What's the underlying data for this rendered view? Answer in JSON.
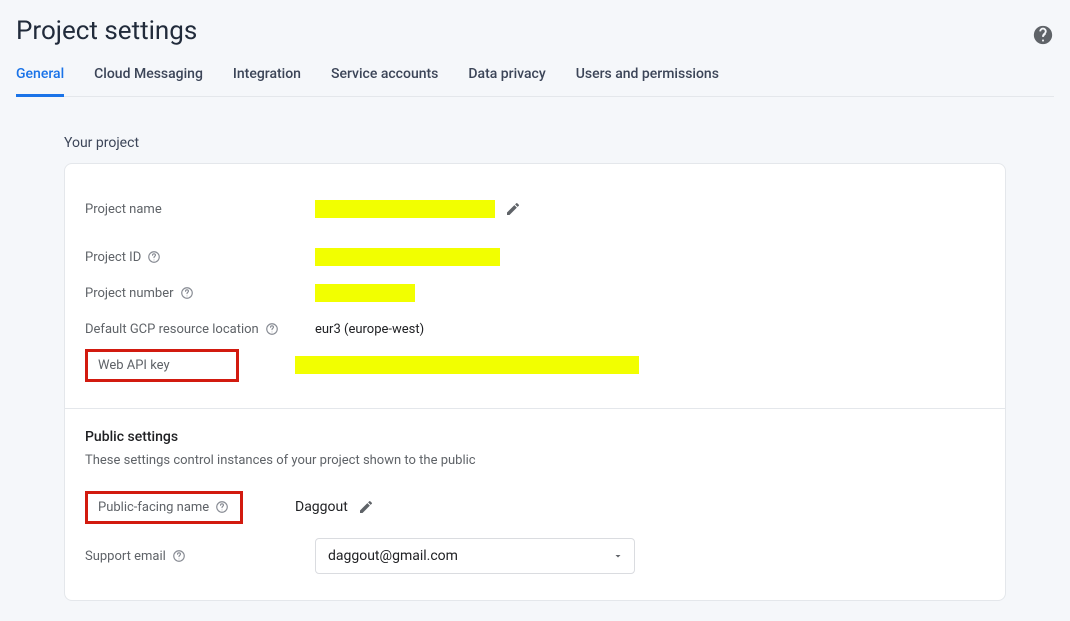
{
  "header": {
    "title": "Project settings"
  },
  "tabs": {
    "general": "General",
    "cloud_messaging": "Cloud Messaging",
    "integration": "Integration",
    "service_accounts": "Service accounts",
    "data_privacy": "Data privacy",
    "users_permissions": "Users and permissions"
  },
  "section": {
    "your_project": "Your project"
  },
  "labels": {
    "project_name": "Project name",
    "project_id": "Project ID",
    "project_number": "Project number",
    "default_gcp": "Default GCP resource location",
    "web_api_key": "Web API key",
    "public_settings_heading": "Public settings",
    "public_settings_desc": "These settings control instances of your project shown to the public",
    "public_facing_name": "Public-facing name",
    "support_email": "Support email"
  },
  "values": {
    "default_gcp": "eur3 (europe-west)",
    "public_facing_name": "Daggout",
    "support_email": "daggout@gmail.com"
  }
}
